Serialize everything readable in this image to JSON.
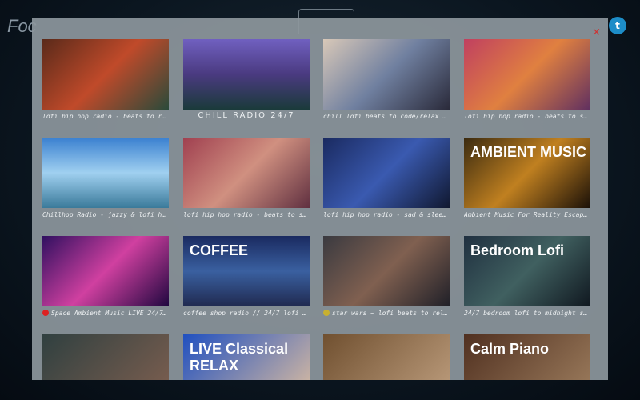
{
  "header": {
    "brand": "Foc",
    "close_label": "×",
    "twitter_icon": "twitter-icon"
  },
  "videos": [
    {
      "title": "lofi hip hop radio - beats to re…",
      "bg": "linear-gradient(135deg,#5a2a1a,#c04a2a 50%,#2a4a3a)"
    },
    {
      "title": "CHILL RADIO 24/7",
      "bg": "linear-gradient(180deg,#7060c0,#4a3a80 50%,#1a3a3a)"
    },
    {
      "title": "chill lofi beats to code/relax to",
      "bg": "linear-gradient(135deg,#d8c8b8,#7080a0 50%,#2a2a3a)"
    },
    {
      "title": "lofi hip hop radio - beats to sl…",
      "bg": "linear-gradient(135deg,#c04060,#e08040 50%,#603060)"
    },
    {
      "title": "Chillhop Radio - jazzy & lofi hi…",
      "bg": "linear-gradient(180deg,#3a80d0,#a0d0f0 50%,#3a7a9a)"
    },
    {
      "title": "lofi hip hop radio - beats to st…",
      "bg": "linear-gradient(135deg,#a04050,#d09080 50%,#603040)"
    },
    {
      "title": "lofi hip hop radio - sad & sleep…",
      "bg": "linear-gradient(135deg,#1a2a60,#3a5ab0 50%,#101830)"
    },
    {
      "title": "Ambient Music For Reality Escape…",
      "bg": "linear-gradient(135deg,#3a2a10,#c08020 50%,#1a1008)",
      "overlay": "AMBIENT MUSIC"
    },
    {
      "title": "Space Ambient Music LIVE 24/7…",
      "bg": "linear-gradient(135deg,#301060,#d040a0 50%,#200840)",
      "live": true
    },
    {
      "title": "coffee shop radio // 24/7 lofi h…",
      "bg": "linear-gradient(180deg,#1a2a60,#3a60a0 50%,#202a50)",
      "overlay": "COFFEE"
    },
    {
      "title": "star wars ~ lofi beats to rel…",
      "bg": "linear-gradient(135deg,#3a3a40,#806050 50%,#202028)",
      "badge": true
    },
    {
      "title": "24/7 bedroom lofi to midnight sl…",
      "bg": "linear-gradient(135deg,#203040,#406060 50%,#101820)",
      "overlay": "Bedroom Lofi"
    },
    {
      "title": "",
      "bg": "linear-gradient(135deg,#304040,#806050)"
    },
    {
      "title": "",
      "bg": "linear-gradient(135deg,#2050c0,#e0c0a0)",
      "overlay": "LIVE Classical RELAX"
    },
    {
      "title": "",
      "bg": "linear-gradient(135deg,#705030,#c0a080)"
    },
    {
      "title": "",
      "bg": "linear-gradient(135deg,#503020,#a08060)",
      "overlay": "Calm Piano"
    }
  ]
}
